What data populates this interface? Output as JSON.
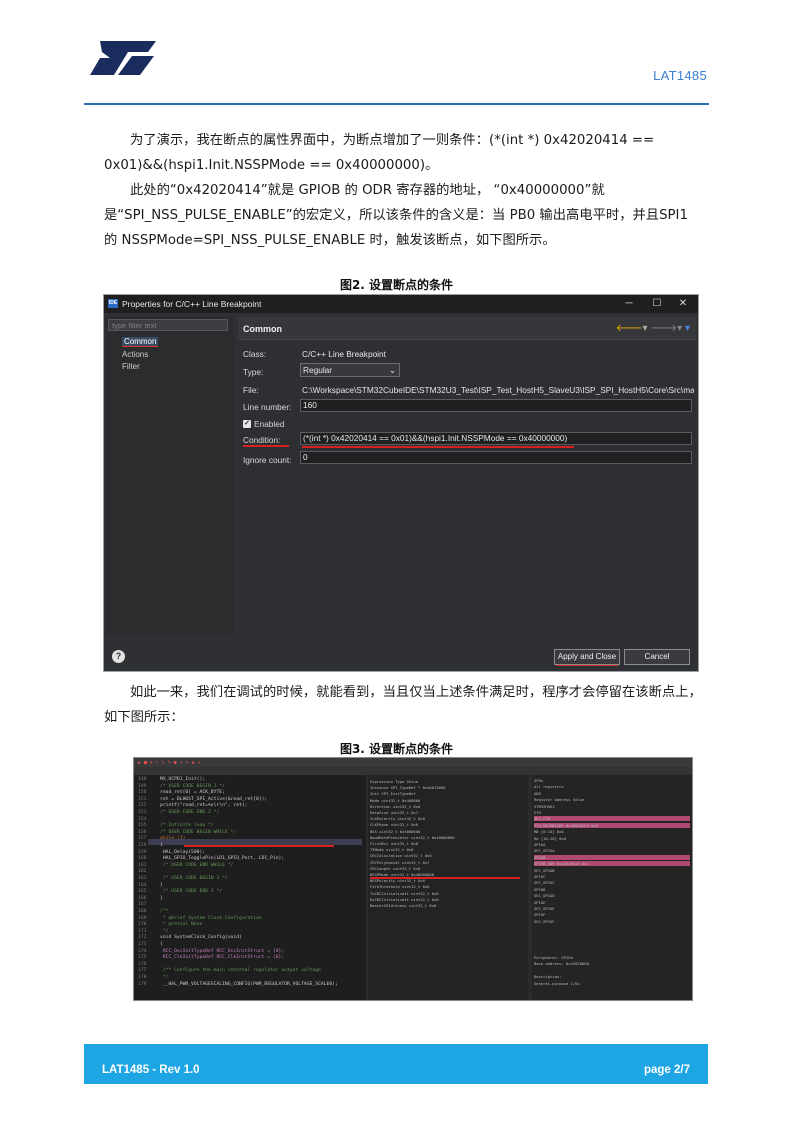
{
  "header": {
    "doc_id": "LAT1485"
  },
  "body": {
    "para1": "为了演示，我在断点的属性界面中，为断点增加了一则条件：(*(int *) 0x42020414 == 0x01)&&(hspi1.Init.NSSPMode == 0x40000000)。",
    "para2": "此处的“0x42020414”就是 GPIOB 的 ODR 寄存器的地址， “0x40000000”就是“SPI_NSS_PULSE_ENABLE”的宏定义，所以该条件的含义是：当 PB0 输出高电平时，并且SPI1 的 NSSPMode=SPI_NSS_PULSE_ENABLE 时，触发该断点，如下图所示。",
    "para3": "如此一来，我们在调试的时候，就能看到，当且仅当上述条件满足时，程序才会停留在该断点上，如下图所示："
  },
  "figure2": {
    "caption": "图2. 设置断点的条件",
    "dialog": {
      "title": "Properties for C/C++ Line Breakpoint",
      "icon_label": "IDE",
      "filter_placeholder": "type filter text",
      "nav": [
        "Common",
        "Actions",
        "Filter"
      ],
      "section": "Common",
      "fields": {
        "class_label": "Class:",
        "class_value": "C/C++ Line Breakpoint",
        "type_label": "Type:",
        "type_value": "Regular",
        "file_label": "File:",
        "file_value": "C:\\Workspace\\STM32CubeIDE\\STM32U3_Test\\ISP_Test_HostH5_SlaveU3\\ISP_SPI_HostH5\\Core\\Src\\main.c",
        "line_label": "Line number:",
        "line_value": "160",
        "enabled_label": "Enabled",
        "condition_label": "Condition:",
        "condition_value": "(*(int *) 0x42020414 == 0x01)&&(hspi1.Init.NSSPMode == 0x40000000)",
        "ignore_label": "Ignore count:",
        "ignore_value": "0"
      },
      "buttons": {
        "apply_close": "Apply and Close",
        "cancel": "Cancel"
      }
    }
  },
  "figure3": {
    "caption": "图3. 设置断点的条件",
    "code_lines": [
      {
        "n": "148",
        "t": "MX_UCPD1_Init();",
        "c": ""
      },
      {
        "n": "149",
        "t": "/* USER CODE BEGIN 2 */",
        "c": "cm"
      },
      {
        "n": "150",
        "t": "read_ret[0] = ACK_BYTE;",
        "c": ""
      },
      {
        "n": "151",
        "t": "ret = BLHOST_SPI_Active(&read_ret[0]);",
        "c": ""
      },
      {
        "n": "152",
        "t": "printf(\"read_ret=%x\\r\\n\", ret);",
        "c": ""
      },
      {
        "n": "153",
        "t": "/* USER CODE END 2 */",
        "c": "cm"
      },
      {
        "n": "154",
        "t": "",
        "c": ""
      },
      {
        "n": "155",
        "t": "/* Infinite loop */",
        "c": "cm"
      },
      {
        "n": "156",
        "t": "/* USER CODE BEGIN WHILE */",
        "c": "cm"
      },
      {
        "n": "157",
        "t": "while (1)",
        "c": "kw"
      },
      {
        "n": "158",
        "t": "{",
        "c": ""
      },
      {
        "n": "159",
        "t": "    HAL_Delay(500);",
        "c": ""
      },
      {
        "n": "160",
        "t": "    HAL_GPIO_TogglePin(LD1_GPIO_Port, LD1_Pin);",
        "c": ""
      },
      {
        "n": "161",
        "t": "  /* USER CODE END WHILE */",
        "c": "cm"
      },
      {
        "n": "162",
        "t": "",
        "c": ""
      },
      {
        "n": "163",
        "t": "  /* USER CODE BEGIN 3 */",
        "c": "cm"
      },
      {
        "n": "164",
        "t": "}",
        "c": ""
      },
      {
        "n": "165",
        "t": "  /* USER CODE END 3 */",
        "c": "cm"
      },
      {
        "n": "166",
        "t": "}",
        "c": ""
      },
      {
        "n": "167",
        "t": "",
        "c": ""
      },
      {
        "n": "168",
        "t": "/**",
        "c": "cm"
      },
      {
        "n": "169",
        "t": " * @brief System Clock Configuration",
        "c": "cm"
      },
      {
        "n": "170",
        "t": " * @retval None",
        "c": "cm"
      },
      {
        "n": "171",
        "t": " */",
        "c": "cm"
      },
      {
        "n": "172",
        "t": "void SystemClock_Config(void)",
        "c": ""
      },
      {
        "n": "173",
        "t": "{",
        "c": ""
      },
      {
        "n": "174",
        "t": "  RCC_OscInitTypeDef RCC_OscInitStruct = {0};",
        "c": "mac"
      },
      {
        "n": "175",
        "t": "  RCC_ClkInitTypeDef RCC_ClkInitStruct = {0};",
        "c": "mac"
      },
      {
        "n": "176",
        "t": "",
        "c": ""
      },
      {
        "n": "177",
        "t": "  /** Configure the main internal regulator output voltage",
        "c": "cm"
      },
      {
        "n": "178",
        "t": "  */",
        "c": "cm"
      },
      {
        "n": "179",
        "t": "  __HAL_PWR_VOLTAGESCALING_CONFIG(PWR_REGULATOR_VOLTAGE_SCALE0);",
        "c": ""
      }
    ],
    "var_rows": [
      "Expression          Type              Value",
      "Instance            SPI_TypeDef *     0x40013000",
      "Init                SPI_InitTypeDef",
      "Mode                uint32_t          0x400000",
      "Direction           uint32_t          0x0",
      "DataSize            uint32_t          0x7",
      "CLKPolarity         uint32_t          0x0",
      "CLKPhase            uint32_t          0x0",
      "NSS                 uint32_t          0x4000000",
      "BaudRatePrescaler   uint32_t          0x40000000",
      "FirstBit            uint32_t          0x0",
      "TIMode              uint32_t          0x0",
      "CRCCalculation      uint32_t          0x0",
      "CRCPolynomial       uint32_t          0x7",
      "CRCLength           uint32_t          0x0",
      "NSSPMode            uint32_t          0x40000000",
      "NSSPolarity         uint32_t          0x0",
      "FifoThreshold       uint32_t          0x0",
      "TxCRCInitializati   uint32_t          0x0",
      "RxCRCInitializati   uint32_t          0x0",
      "MasterSSIdleness    uint32_t          0x0"
    ],
    "reg_rows": [
      "SFRs",
      "All registers",
      "ODR",
      "Register             Address     Value",
      "STM32H563",
      "ETH",
      "SEC_ETH",
      "ETH_MACMDIODR       0x40028204  0x0",
      "MD    [0:15]   0x0",
      "RA    [16:20]  0x0",
      "GPIOA",
      "SEC_GPIOA",
      "GPIOB",
      "GPIOB_ODR           0x42020414  0x1",
      "SEC_GPIOB",
      "GPIOC",
      "SEC_GPIOC",
      "GPIOD",
      "SEC_GPIOD",
      "GPIOE",
      "SEC_GPIOE",
      "GPIOF",
      "SEC_GPIOF"
    ],
    "reg_info": [
      "Peripheral:   GPIOA",
      "Base address:   0x42020000",
      "",
      "Description:",
      "General-purpose I/Os"
    ]
  },
  "footer": {
    "left": "LAT1485  - Rev 1.0",
    "right": "page 2/7"
  },
  "colors": {
    "brand_blue": "#2b6fb8",
    "footer_blue": "#1ea6e4",
    "red_mark": "#d42222"
  }
}
